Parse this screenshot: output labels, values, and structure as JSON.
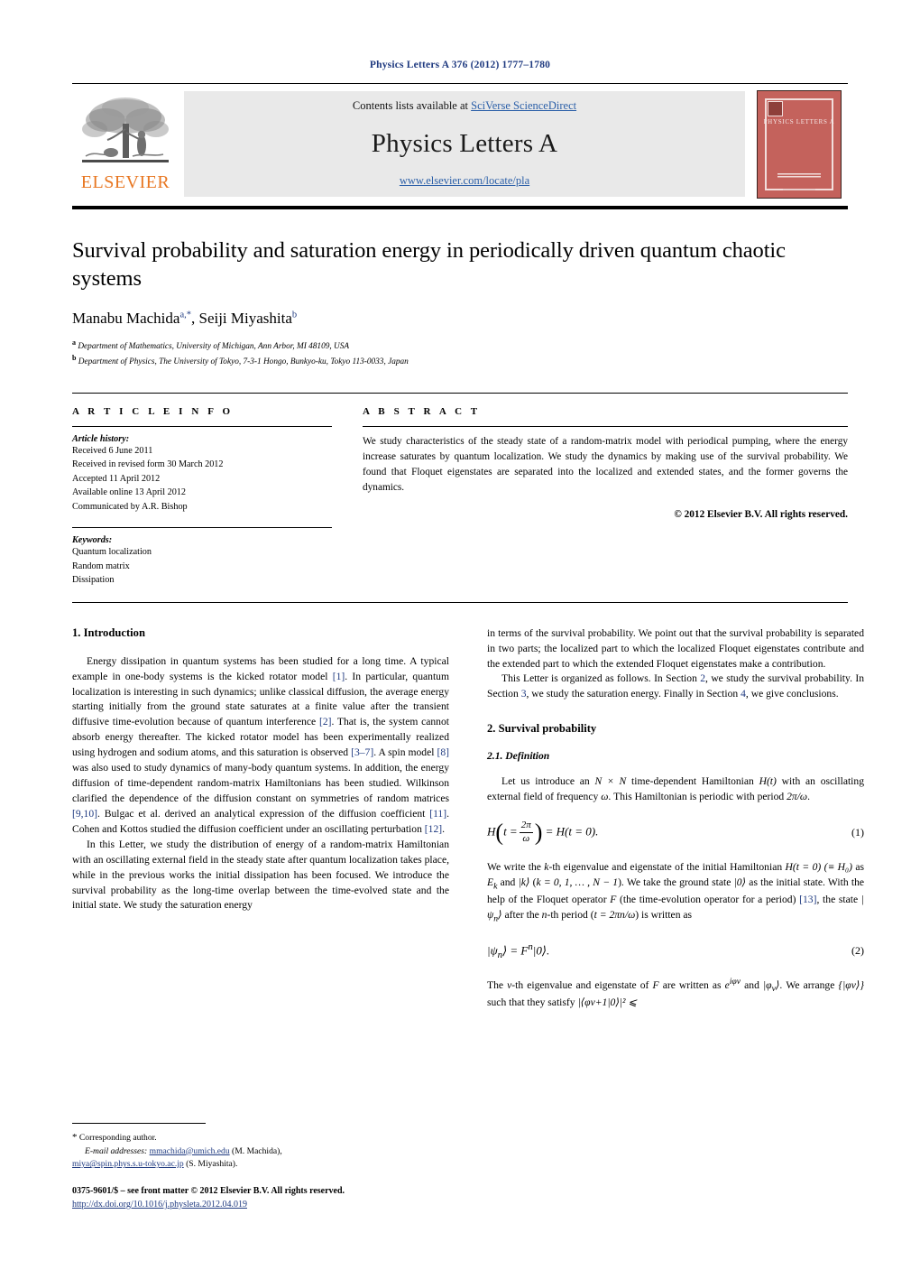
{
  "running_head": "Physics Letters A 376 (2012) 1777–1780",
  "masthead": {
    "publisher": "ELSEVIER",
    "contents_prefix": "Contents lists available at ",
    "contents_link": "SciVerse ScienceDirect",
    "journal_title": "Physics Letters A",
    "journal_url": "www.elsevier.com/locate/pla",
    "cover_title": "PHYSICS LETTERS A"
  },
  "article": {
    "title": "Survival probability and saturation energy in periodically driven quantum chaotic systems",
    "author1": "Manabu Machida",
    "author1_sup": "a,*",
    "author_sep": ", ",
    "author2": "Seiji Miyashita",
    "author2_sup": "b",
    "affiliation_a_marker": "a",
    "affiliation_a": "Department of Mathematics, University of Michigan, Ann Arbor, MI 48109, USA",
    "affiliation_b_marker": "b",
    "affiliation_b": "Department of Physics, The University of Tokyo, 7-3-1 Hongo, Bunkyo-ku, Tokyo 113-0033, Japan"
  },
  "info": {
    "heading": "A R T I C L E   I N F O",
    "history_label": "Article history:",
    "history": [
      "Received 6 June 2011",
      "Received in revised form 30 March 2012",
      "Accepted 11 April 2012",
      "Available online 13 April 2012",
      "Communicated by A.R. Bishop"
    ],
    "keywords_label": "Keywords:",
    "keywords": [
      "Quantum localization",
      "Random matrix",
      "Dissipation"
    ]
  },
  "abstract": {
    "heading": "A B S T R A C T",
    "text": "We study characteristics of the steady state of a random-matrix model with periodical pumping, where the energy increase saturates by quantum localization. We study the dynamics by making use of the survival probability. We found that Floquet eigenstates are separated into the localized and extended states, and the former governs the dynamics.",
    "copyright": "© 2012 Elsevier B.V. All rights reserved."
  },
  "sections": {
    "intro_heading": "1. Introduction",
    "intro_p1_a": "Energy dissipation in quantum systems has been studied for a long time. A typical example in one-body systems is the kicked rotator model ",
    "intro_p1_cite1": "[1]",
    "intro_p1_b": ". In particular, quantum localization is interesting in such dynamics; unlike classical diffusion, the average energy starting initially from the ground state saturates at a finite value after the transient diffusive time-evolution because of quantum interference ",
    "intro_p1_cite2": "[2]",
    "intro_p1_c": ". That is, the system cannot absorb energy thereafter. The kicked rotator model has been experimentally realized using hydrogen and sodium atoms, and this saturation is observed ",
    "intro_p1_cite3": "[3–7]",
    "intro_p1_d": ". A spin model ",
    "intro_p1_cite4": "[8]",
    "intro_p1_e": " was also used to study dynamics of many-body quantum systems. In addition, the energy diffusion of time-dependent random-matrix Hamiltonians has been studied. Wilkinson clarified the dependence of the diffusion constant on symmetries of random matrices ",
    "intro_p1_cite5": "[9,10]",
    "intro_p1_f": ". Bulgac et al. derived an analytical expression of the diffusion coefficient ",
    "intro_p1_cite6": "[11]",
    "intro_p1_g": ". Cohen and Kottos studied the diffusion coefficient under an oscillating perturbation ",
    "intro_p1_cite7": "[12]",
    "intro_p1_h": ".",
    "intro_p2": "In this Letter, we study the distribution of energy of a random-matrix Hamiltonian with an oscillating external field in the steady state after quantum localization takes place, while in the previous works the initial dissipation has been focused. We introduce the survival probability as the long-time overlap between the time-evolved state and the initial state. We study the saturation energy",
    "right_p1": "in terms of the survival probability. We point out that the survival probability is separated in two parts; the localized part to which the localized Floquet eigenstates contribute and the extended part to which the extended Floquet eigenstates make a contribution.",
    "right_p2_a": "This Letter is organized as follows. In Section ",
    "right_p2_s2": "2",
    "right_p2_b": ", we study the survival probability. In Section ",
    "right_p2_s3": "3",
    "right_p2_c": ", we study the saturation energy. Finally in Section ",
    "right_p2_s4": "4",
    "right_p2_d": ", we give conclusions.",
    "survival_heading": "2. Survival probability",
    "definition_heading": "2.1. Definition",
    "def_p1_a": "Let us introduce an ",
    "def_p1_nn": "N × N",
    "def_p1_b": " time-dependent Hamiltonian ",
    "def_p1_h": "H(t)",
    "def_p1_c": " with an oscillating external field of frequency ",
    "def_p1_w": "ω",
    "def_p1_d": ". This Hamiltonian is periodic with period ",
    "def_p1_per": "2π/ω",
    "def_p1_e": ".",
    "eq1_num": "(1)",
    "eq1_lhs_sym": "H",
    "eq1_var": "t =",
    "eq1_frac_num": "2π",
    "eq1_frac_den": "ω",
    "eq1_rhs": "= H(t = 0).",
    "def_p2_a": "We write the ",
    "def_p2_k": "k",
    "def_p2_b": "-th eigenvalue and eigenstate of the initial Hamiltonian ",
    "def_p2_ham": "H(t = 0) (≡ H₀)",
    "def_p2_c": " as ",
    "def_p2_ek": "E",
    "def_p2_eksub": "k",
    "def_p2_d": " and ",
    "def_p2_ket": "|k⟩",
    "def_p2_e": " (",
    "def_p2_range": "k = 0, 1, … , N − 1",
    "def_p2_f": "). We take the ground state ",
    "def_p2_g0": "|0⟩",
    "def_p2_g": " as the initial state. With the help of the Floquet operator ",
    "def_p2_F": "F",
    "def_p2_h": " (the time-evolution operator for a period) ",
    "def_p2_cite": "[13]",
    "def_p2_i": ", the state ",
    "def_p2_psi": "|ψ",
    "def_p2_psisub": "n",
    "def_p2_psiend": "⟩",
    "def_p2_j": " after the ",
    "def_p2_n": "n",
    "def_p2_k2": "-th period (",
    "def_p2_tper": "t = 2πn/ω",
    "def_p2_l": ") is written as",
    "eq2_num": "(2)",
    "eq2_lhs": "|ψ",
    "eq2_lhs_sub": "n",
    "eq2_mid": "⟩ = F",
    "eq2_sup": "n",
    "eq2_end": "|0⟩.",
    "def_p3_a": "The ",
    "def_p3_nu": "ν",
    "def_p3_b": "-th eigenvalue and eigenstate of ",
    "def_p3_F": "F",
    "def_p3_c": " are written as ",
    "def_p3_e": "e",
    "def_p3_esup": "iφν",
    "def_p3_d": " and ",
    "def_p3_phi": "|φ",
    "def_p3_phisub": "ν",
    "def_p3_phiend": "⟩",
    "def_p3_f": ". We arrange ",
    "def_p3_set": "{|φν⟩}",
    "def_p3_g": " such that they satisfy ",
    "def_p3_ineq": "|⟨φν+1|0⟩|² ⩽"
  },
  "footnote": {
    "star": "*",
    "corresponding": "Corresponding author.",
    "email_label": "E-mail addresses:",
    "email1": "mmachida@umich.edu",
    "email1_who": "(M. Machida),",
    "email2": "miya@spin.phys.s.u-tokyo.ac.jp",
    "email2_who": "(S. Miyashita).",
    "imprint": "0375-9601/$ – see front matter  © 2012 Elsevier B.V. All rights reserved.",
    "doi": "http://dx.doi.org/10.1016/j.physleta.2012.04.019"
  },
  "colors": {
    "link_blue": "#1f3a80",
    "sciencedirect_blue": "#2b5fa8",
    "elsevier_orange": "#E87722",
    "cover_red": "#c4625c",
    "band_gray": "#e9e9e9"
  }
}
